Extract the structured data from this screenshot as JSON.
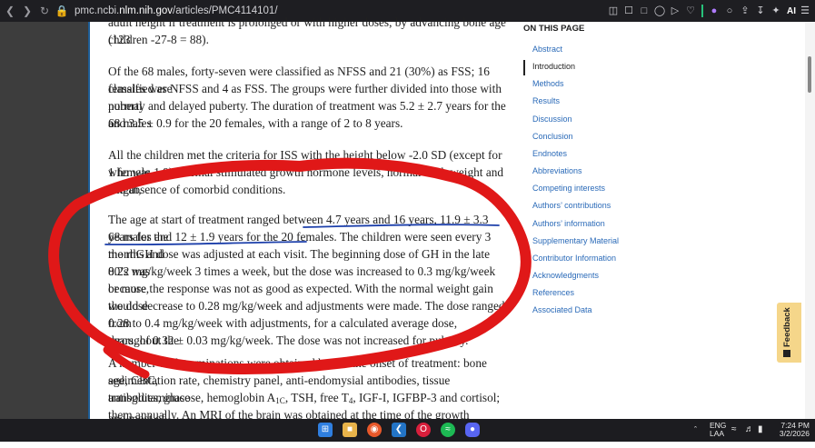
{
  "browser": {
    "url_prefix": "pmc.ncbi.",
    "url_domain": "nlm.nih.gov",
    "url_path": "/articles/PMC4114101/",
    "ai_label": "AI"
  },
  "article": {
    "para1_line1": "adult height if treatment is prolonged or with higher doses, by advancing bone age (123",
    "para1_line2": "children -27-8 = 88).",
    "para2_lines": [
      "Of the 68 males, forty-seven were classified as NFSS and 21 (30%) as FSS; 16 females were",
      "classified as NFSS and 4 as FSS. The groups were further divided into those with normal",
      "puberty and delayed puberty. The duration of treatment was 5.2 ± 2.7 years for the 68 males",
      "and 3.5 ± 0.9 for the 20 females, with a range of 2 to 8 years."
    ],
    "para3_lines": [
      "All the children met the criteria for ISS with the height below -2.0 SD (except for 1 female",
      "who was 1.9), normal stimulated growth hormone levels, normal birth weight and length,",
      "and absence of comorbid conditions."
    ],
    "para4_lines": [
      "The age at start of treatment ranged between 4.7 years and 16 years, 11.9 ± 3.3 years for the",
      "68 males and 12 ± 1.9 years for the 20 females. The children were seen every 3 months and",
      "the rhGH dose was adjusted at each visit. The beginning dose of GH in the late 80’s was",
      "0.22 mg/kg/week 3 times a week, but the dose was increased to 0.3 mg/kg/week or more,",
      "because the response was not as good as expected. With the normal weight gain the dose",
      "would decrease to 0.28 mg/kg/week and adjustments were made. The dose ranged from",
      "0.28 to 0.4 mg/kg/week with adjustments, for a calculated average dose, throughout the",
      "years, of 0.32 ± 0.03 mg/kg/week. The dose was not increased for puberty."
    ],
    "para5_line1": "A number of determinations were obtained before the onset of treatment: bone age, CBC,",
    "para5_line2": "sedimentation rate, chemistry panel, anti-endomysial antibodies, tissue transglutaminase",
    "para5_line3_a": "antibodies, glucose, hemoglobin A",
    "para5_line3_sub1": "1C",
    "para5_line3_b": ", TSH, free T",
    "para5_line3_sub2": "4",
    "para5_line3_c": ", IGF-I, IGFBP-3 and cortisol; and most of",
    "para5_line4": "them annually. An MRI of the brain was obtained at the time of the growth hormone"
  },
  "sidebar": {
    "heading": "ON THIS PAGE",
    "items": [
      {
        "label": "Abstract",
        "active": false
      },
      {
        "label": "Introduction",
        "active": true
      },
      {
        "label": "Methods",
        "active": false
      },
      {
        "label": "Results",
        "active": false
      },
      {
        "label": "Discussion",
        "active": false
      },
      {
        "label": "Conclusion",
        "active": false
      },
      {
        "label": "Endnotes",
        "active": false
      },
      {
        "label": "Abbreviations",
        "active": false
      },
      {
        "label": "Competing interests",
        "active": false
      },
      {
        "label": "Authors’ contributions",
        "active": false
      },
      {
        "label": "Authors’ information",
        "active": false
      },
      {
        "label": "Supplementary Material",
        "active": false
      },
      {
        "label": "Contributor Information",
        "active": false
      },
      {
        "label": "Acknowledgments",
        "active": false
      },
      {
        "label": "References",
        "active": false
      },
      {
        "label": "Associated Data",
        "active": false
      }
    ]
  },
  "feedback": {
    "label": "Feedback"
  },
  "taskbar": {
    "lang_top": "ENG",
    "lang_bottom": "LAA",
    "time": "7:24 PM",
    "date": "3/2/2026"
  },
  "colors": {
    "annotation_red": "#e01818",
    "underline_blue": "#1c3faa",
    "link": "#2a6ab8",
    "feedback_bg": "#f5d68a"
  }
}
